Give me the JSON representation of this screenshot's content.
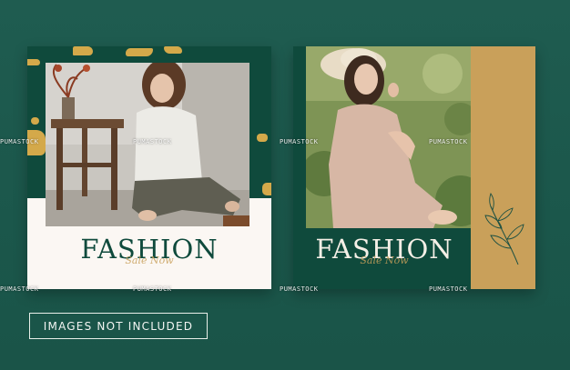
{
  "left_card": {
    "title": "FASHION",
    "script_text": "Sale Now"
  },
  "right_card": {
    "title": "FASHION",
    "script_text": "Sale Now"
  },
  "watermark": {
    "text": "PUMASTOCK"
  },
  "label": {
    "text": "IMAGES NOT INCLUDED"
  },
  "colors": {
    "background": "#1d5a4f",
    "dark_green": "#0f4a3c",
    "gold": "#c9a05a",
    "cream": "#fbf7f3"
  }
}
